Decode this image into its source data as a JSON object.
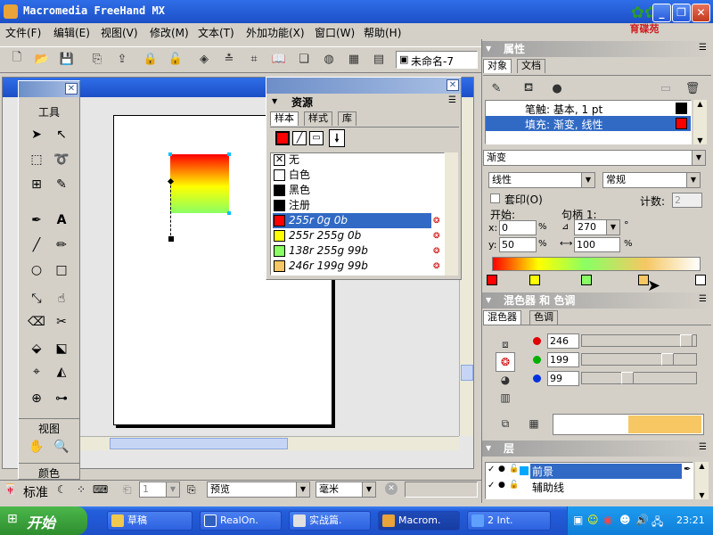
{
  "app": {
    "title": "Macromedia FreeHand MX",
    "logo_text": "育碟苑"
  },
  "menu": [
    "文件(F)",
    "编辑(E)",
    "视图(V)",
    "修改(M)",
    "文本(T)",
    "外加功能(X)",
    "窗口(W)",
    "帮助(H)"
  ],
  "toolbar": {
    "doc_name": "未命名-7"
  },
  "tools_panel": {
    "title": "工具",
    "view_label": "视图",
    "color_label": "颜色"
  },
  "swatches": {
    "title": "资源",
    "tabs": [
      "样本",
      "样式",
      "库"
    ],
    "items": [
      {
        "label": "无",
        "color": "#ffffff"
      },
      {
        "label": "白色",
        "color": "#ffffff"
      },
      {
        "label": "黑色",
        "color": "#000000"
      },
      {
        "label": "注册",
        "color": "#000000"
      },
      {
        "label": "255r 0g 0b",
        "color": "#ff0000"
      },
      {
        "label": "255r 255g 0b",
        "color": "#ffff00"
      },
      {
        "label": "138r 255g 99b",
        "color": "#8aff63"
      },
      {
        "label": "246r 199g 99b",
        "color": "#f6c763"
      }
    ]
  },
  "properties": {
    "title": "属性",
    "tabs": [
      "对象",
      "文档"
    ],
    "stroke_label": "笔触: 基本, 1 pt",
    "fill_label": "填充: 渐变, 线性",
    "fill_type": "渐变",
    "gradient_kind": "线性",
    "blend_mode": "常规",
    "overprint_label": "套印(O)",
    "count_label": "计数:",
    "count_value": "2",
    "start_label": "开始:",
    "handle_label": "句柄 1:",
    "x_label": "x:",
    "x_value": "0",
    "y_label": "y:",
    "y_value": "50",
    "pct": "%",
    "angle_value": "270",
    "degree": "°",
    "width_value": "100"
  },
  "mixer": {
    "title": "混色器 和 色调",
    "tabs": [
      "混色器",
      "色调"
    ],
    "r": "246",
    "g": "199",
    "b": "99",
    "r_level": 0.965,
    "g_level": 0.78,
    "b_level": 0.39,
    "preview_color": "#f6c763"
  },
  "layers": {
    "title": "层",
    "items": [
      {
        "name": "前景",
        "selected": true
      },
      {
        "name": "辅助线",
        "selected": false
      }
    ]
  },
  "statusbar": {
    "mode": "标准",
    "page": "1",
    "view": "预览",
    "units": "毫米"
  },
  "taskbar": {
    "start": "开始",
    "items": [
      "草稿",
      "RealOn.",
      "实战篇.",
      "Macrom.",
      "2 Int."
    ],
    "clock": "23:21"
  },
  "colors": {
    "accent": "#0a246a",
    "xp_blue": "#245edb",
    "gradient": [
      "#ff0000",
      "#ffff00",
      "#8aff63",
      "#f6c763",
      "#ffffff"
    ]
  }
}
